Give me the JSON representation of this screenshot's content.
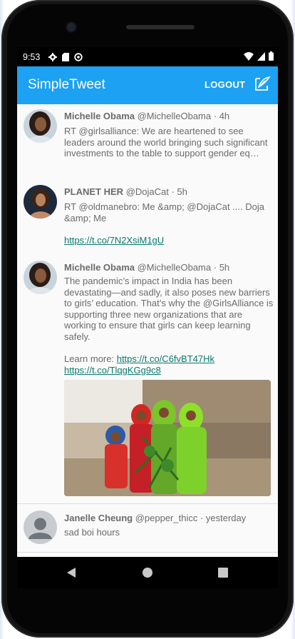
{
  "status_bar": {
    "time": "9:53"
  },
  "app_bar": {
    "title": "SimpleTweet",
    "logout_label": "LOGOUT"
  },
  "tweets": [
    {
      "name": "Michelle Obama",
      "handle": "@MichelleObama",
      "time": "· 4h",
      "body": "RT @girlsalliance: We are heartened to see leaders around the world bringing such significant investments to the table to support gender eq…"
    },
    {
      "name": "PLANET HER",
      "handle": "@DojaCat",
      "time": "· 5h",
      "body": "RT @oldmanebro: Me &amp; @DojaCat .... Doja &amp; Me",
      "link": "https://t.co/7N2XsiM1gU"
    },
    {
      "name": "Michelle Obama",
      "handle": "@MichelleObama",
      "time": "· 5h",
      "body": "The pandemic’s impact in India has been devastating—and sadly, it also poses new barriers to girls’ education. That’s why the @GirlsAlliance is supporting three new organizations that are working to ensure that girls can keep learning safely.",
      "learn_more": "Learn more:",
      "link1": "https://t.co/C6fvBT47Hk",
      "link2": "https://t.co/TlqgKGg9c8"
    },
    {
      "name": "Janelle Cheung",
      "handle": "@pepper_thicc",
      "time": "· yesterday",
      "body": "sad boi hours"
    }
  ],
  "colors": {
    "app_bar": "#1da1f2",
    "link": "#0a7a6e",
    "text_gray": "#6b6b6b"
  }
}
